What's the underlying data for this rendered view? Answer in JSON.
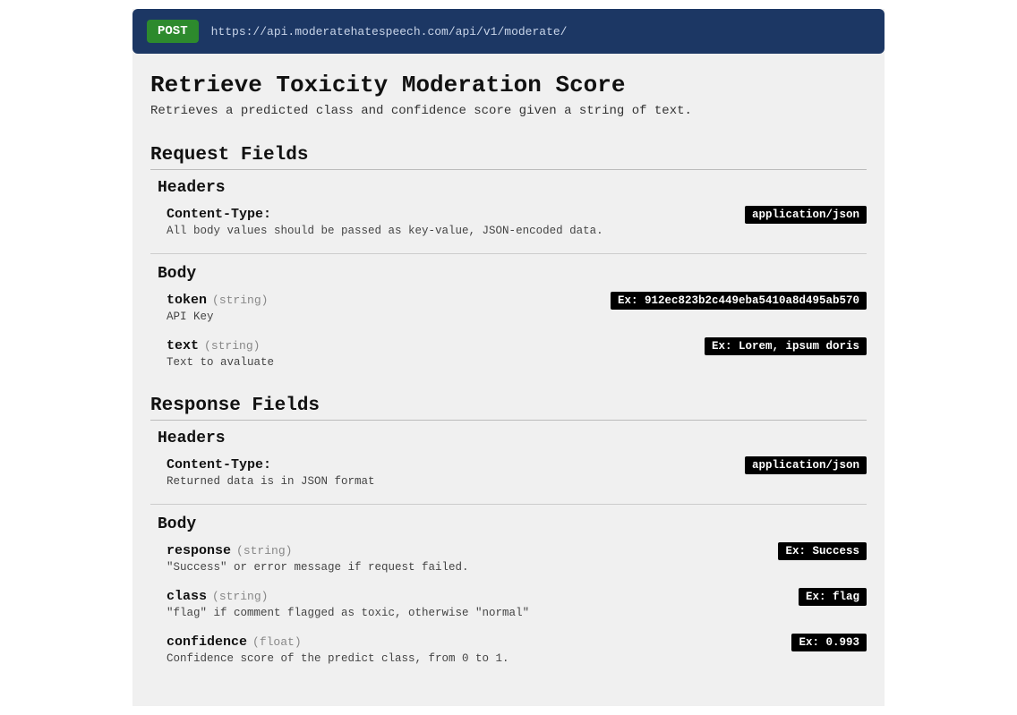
{
  "endpoint": {
    "method": "POST",
    "url": "https://api.moderatehatespeech.com/api/v1/moderate/"
  },
  "title": "Retrieve Toxicity Moderation Score",
  "subtitle": "Retrieves a predicted class and confidence score given a string of text.",
  "request": {
    "heading": "Request Fields",
    "headers_heading": "Headers",
    "header_field": {
      "name": "Content-Type:",
      "desc": "All body values should be passed as key-value, JSON-encoded data.",
      "example": "application/json"
    },
    "body_heading": "Body",
    "body_fields": [
      {
        "name": "token",
        "type": "(string)",
        "desc": "API Key",
        "example": "Ex: 912ec823b2c449eba5410a8d495ab570"
      },
      {
        "name": "text",
        "type": "(string)",
        "desc": "Text to avaluate",
        "example": "Ex: Lorem, ipsum doris"
      }
    ]
  },
  "response": {
    "heading": "Response Fields",
    "headers_heading": "Headers",
    "header_field": {
      "name": "Content-Type:",
      "desc": "Returned data is in JSON format",
      "example": "application/json"
    },
    "body_heading": "Body",
    "body_fields": [
      {
        "name": "response",
        "type": "(string)",
        "desc": "\"Success\" or error message if request failed.",
        "example": "Ex: Success"
      },
      {
        "name": "class",
        "type": "(string)",
        "desc": "\"flag\" if comment flagged as toxic, otherwise \"normal\"",
        "example": "Ex: flag"
      },
      {
        "name": "confidence",
        "type": "(float)",
        "desc": "Confidence score of the predict class, from 0 to 1.",
        "example": "Ex: 0.993"
      }
    ]
  }
}
